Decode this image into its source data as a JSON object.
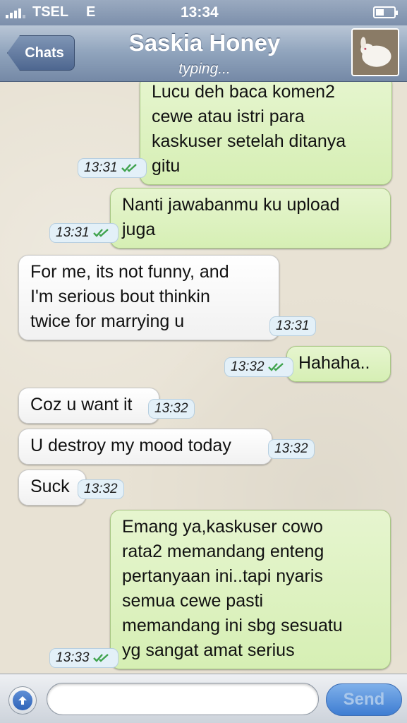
{
  "status_bar": {
    "carrier": "TSEL",
    "network": "E",
    "time": "13:34",
    "battery_level": 0.45
  },
  "nav": {
    "back_label": "Chats",
    "contact_name": "Saskia Honey",
    "contact_status": "typing..."
  },
  "messages": [
    {
      "direction": "out",
      "text": "Lucu deh baca komen2\ncewe atau istri para\nkaskuser setelah ditanya\ngitu",
      "time": "13:31",
      "read": true
    },
    {
      "direction": "out",
      "text": "Nanti jawabanmu ku upload\njuga",
      "time": "13:31",
      "read": true
    },
    {
      "direction": "in",
      "text": "For me, its not funny, and\nI'm serious bout thinkin\ntwice for marrying u",
      "time": "13:31"
    },
    {
      "direction": "out",
      "text": "Hahaha..",
      "time": "13:32",
      "read": true
    },
    {
      "direction": "in",
      "text": "Coz u want it",
      "time": "13:32"
    },
    {
      "direction": "in",
      "text": "U destroy my mood today",
      "time": "13:32"
    },
    {
      "direction": "in",
      "text": "Suck",
      "time": "13:32"
    },
    {
      "direction": "out",
      "text": "Emang ya,kaskuser cowo\nrata2 memandang enteng\npertanyaan ini..tapi nyaris\nsemua cewe pasti\nmemandang ini sbg sesuatu\nyg sangat amat serius",
      "time": "13:33",
      "read": true
    }
  ],
  "input": {
    "placeholder": "",
    "value": "",
    "send_label": "Send"
  },
  "colors": {
    "outgoing_bubble": "#dcf2c0",
    "incoming_bubble": "#ffffff",
    "read_check": "#3fa34d",
    "send_button": "#4a86d6"
  }
}
